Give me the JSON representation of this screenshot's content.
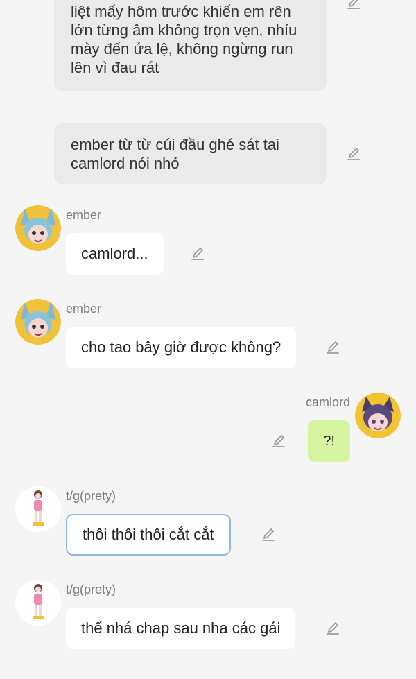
{
  "narrations": [
    "liệt mấy hôm trước khiến em rên lớn từng âm không trọn vẹn, nhíu mày đến ứa lệ, không ngừng run lên vì đau rát",
    "ember từ từ cúi đầu ghé sát tai camlord nói nhỏ"
  ],
  "messages": [
    {
      "sender": "ember",
      "text": "camlord..."
    },
    {
      "sender": "ember",
      "text": "cho tao bây giờ được không?"
    },
    {
      "sender": "camlord",
      "text": "?!"
    },
    {
      "sender": "t/g(prety)",
      "text": "thôi thôi thôi cắt cắt"
    },
    {
      "sender": "t/g(prety)",
      "text": "thế nhá chap sau nha các gái"
    }
  ],
  "icons": {
    "edit": "pencil-edit-icon"
  },
  "colors": {
    "background": "#f5f5f5",
    "narration_bg": "#eaeaea",
    "bubble_bg": "#ffffff",
    "self_bubble_bg": "#d6f5a0",
    "highlight_border": "#8fb9e0"
  }
}
